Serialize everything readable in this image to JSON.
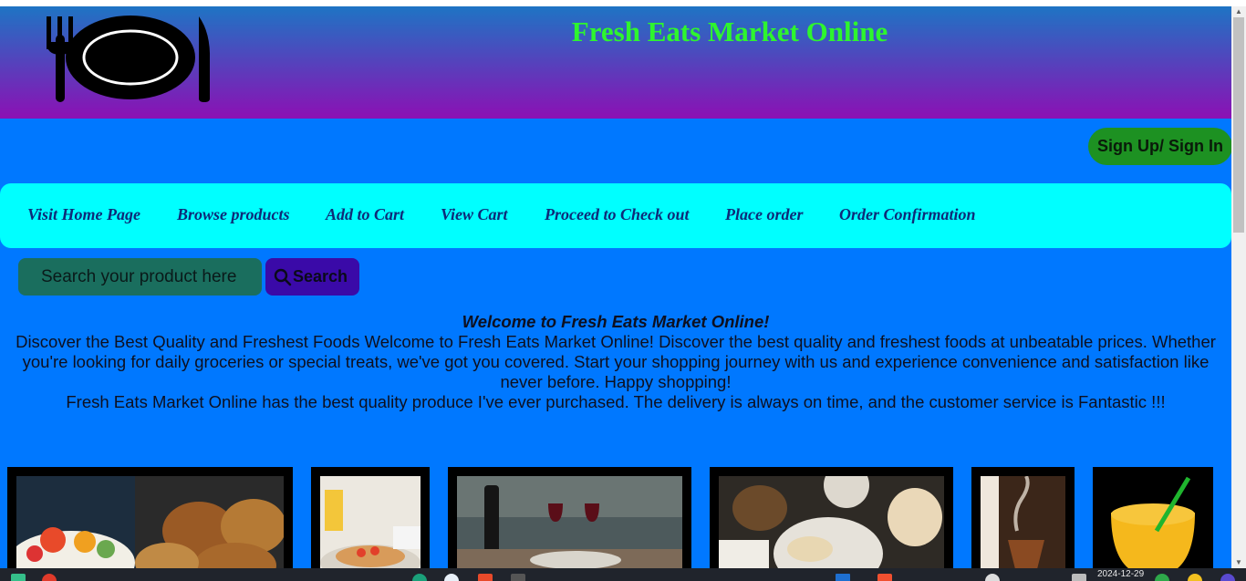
{
  "header": {
    "title": "Fresh Eats Market Online",
    "logo_icon": "plate-fork-knife-icon",
    "title_color": "#2ef52e"
  },
  "account": {
    "signin_label": "Sign Up/ Sign In"
  },
  "nav": {
    "items": [
      "Visit Home Page",
      "Browse products",
      "Add to Cart",
      "View Cart",
      "Proceed to Check out",
      "Place order",
      "Order Confirmation"
    ]
  },
  "search": {
    "placeholder": "Search your product here",
    "button_label": "Search",
    "button_icon": "search-icon"
  },
  "welcome": {
    "heading": "Welcome to Fresh Eats Market Online!",
    "paragraph": "Discover the Best Quality and Freshest Foods Welcome to Fresh Eats Market Online! Discover the best quality and freshest foods at unbeatable prices. Whether you're looking for daily groceries or special treats, we've got you covered. Start your shopping journey with us and experience convenience and satisfaction like never before. Happy shopping!",
    "testimonial": "Fresh Eats Market Online has the best quality produce I've ever purchased. The delivery is always on time, and the customer service is Fantastic !!!"
  },
  "gallery": {
    "images": [
      "salad-and-bagels-photo",
      "pancake-breakfast-photo",
      "wine-dinner-table-photo",
      "bread-and-snacks-photo",
      "steaming-drink-photo",
      "orange-juice-photo"
    ]
  },
  "taskbar": {
    "clock_date": "2024-12-29"
  },
  "colors": {
    "page_background": "#0078ff",
    "nav_background": "#00ffff",
    "signin_background": "#1d9122",
    "search_input_background": "#1a6e5e",
    "search_button_background": "#3a0aa8"
  }
}
